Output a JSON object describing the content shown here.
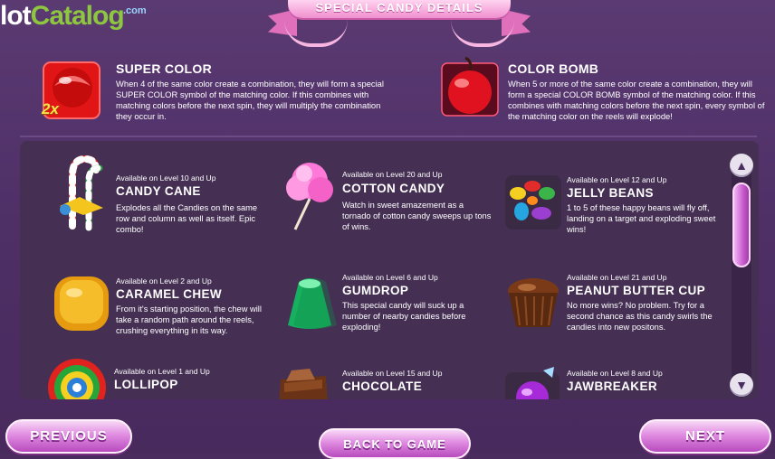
{
  "logo": {
    "part1": "lot",
    "part2": "Catalog",
    "suffix": ".com"
  },
  "banner": {
    "title": "SPECIAL CANDY DETAILS"
  },
  "special": [
    {
      "title": "SUPER COLOR",
      "badge": "2x",
      "desc": "When 4 of the same color create a combination, they will form a special SUPER COLOR symbol of the matching color. If this combines with matching colors before the next spin, they will multiply the combination they occur in."
    },
    {
      "title": "COLOR BOMB",
      "desc": "When 5 or more of the same color create a combination, they will form a special COLOR BOMB symbol of the matching color. If this combines with matching colors before the next spin, every symbol of the matching color on the reels will explode!"
    }
  ],
  "candies": [
    {
      "avail": "Available on Level 10 and Up",
      "name": "CANDY CANE",
      "desc": "Explodes all the Candies on the same row and column as well as itself. Epic combo!"
    },
    {
      "avail": "Available on Level 20 and Up",
      "name": "COTTON CANDY",
      "desc": "Watch in sweet amazement as a tornado of cotton candy sweeps up tons of wins."
    },
    {
      "avail": "Available on Level 12 and Up",
      "name": "JELLY BEANS",
      "desc": "1 to 5 of these happy beans will fly off, landing on a target and exploding sweet wins!"
    },
    {
      "avail": "Available on Level 2 and Up",
      "name": "CARAMEL CHEW",
      "desc": "From it's starting position, the chew will take a random path around the reels, crushing everything in its way."
    },
    {
      "avail": "Available on Level 6 and Up",
      "name": "GUMDROP",
      "desc": "This special candy will suck up a number of nearby candies before exploding!"
    },
    {
      "avail": "Available on Level 21 and Up",
      "name": "PEANUT BUTTER CUP",
      "desc": "No more wins? No problem. Try for a second chance as this candy swirls the candies into new positons."
    },
    {
      "avail": "Available on Level 1 and Up",
      "name": "LOLLIPOP",
      "desc": ""
    },
    {
      "avail": "Available on Level 15 and Up",
      "name": "CHOCOLATE",
      "desc": ""
    },
    {
      "avail": "Available on Level 8 and Up",
      "name": "JAWBREAKER",
      "desc": ""
    }
  ],
  "scroll": {
    "up": "▲",
    "down": "▼"
  },
  "nav": {
    "previous": "PREVIOUS",
    "back": "BACK TO GAME",
    "next": "NEXT"
  },
  "colors": {
    "background": "#4e2f66",
    "panel": "#453054",
    "button": "#e08ce1",
    "logo_green": "#8dc63f"
  }
}
